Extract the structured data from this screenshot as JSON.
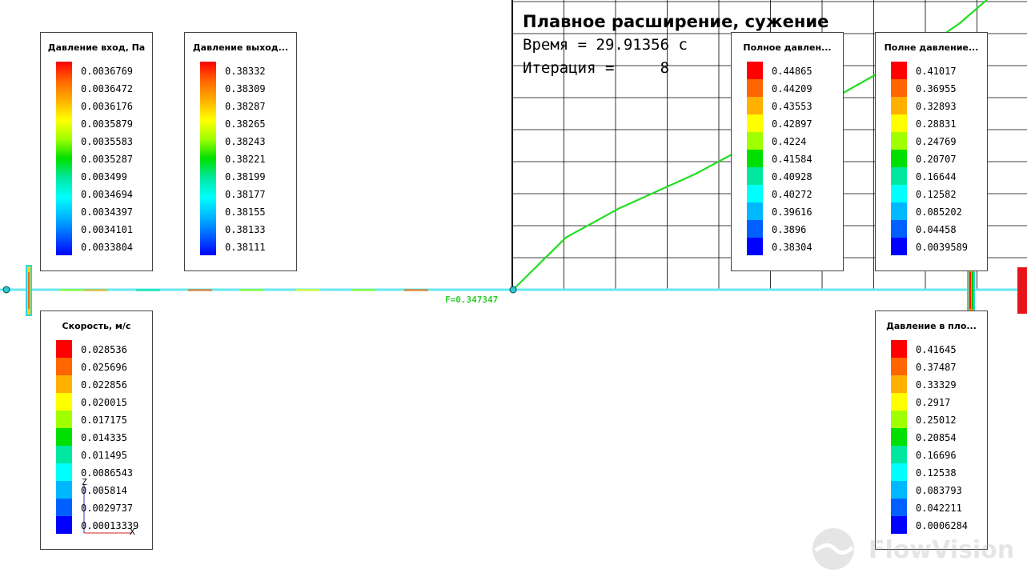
{
  "graph": {
    "title": "Плавное расширение, сужение",
    "time_line": "Время = 29.91356 с",
    "iteration_line": "Итерация =     8",
    "force_label": "F=0.347347",
    "line_color": "#22dd22",
    "curve_points": [
      [
        0,
        0
      ],
      [
        0.11,
        0.18
      ],
      [
        0.22,
        0.28
      ],
      [
        0.38,
        0.4
      ],
      [
        0.55,
        0.55
      ],
      [
        0.72,
        0.71
      ],
      [
        0.86,
        0.84
      ],
      [
        0.93,
        0.92
      ],
      [
        1.0,
        1.02
      ]
    ]
  },
  "legend_colors": [
    "#ff0000",
    "#ff6600",
    "#ffb000",
    "#ffff00",
    "#a0ff00",
    "#00e000",
    "#00e8a0",
    "#00ffff",
    "#00b8ff",
    "#0060ff",
    "#0000ff"
  ],
  "legends": {
    "inlet_pressure": {
      "title": "Давление вход, Па",
      "style": "gradient",
      "values": [
        "0.0036769",
        "0.0036472",
        "0.0036176",
        "0.0035879",
        "0.0035583",
        "0.0035287",
        "0.003499",
        "0.0034694",
        "0.0034397",
        "0.0034101",
        "0.0033804"
      ]
    },
    "outlet_pressure": {
      "title": "Давление выход...",
      "style": "gradient",
      "values": [
        "0.38332",
        "0.38309",
        "0.38287",
        "0.38265",
        "0.38243",
        "0.38221",
        "0.38199",
        "0.38177",
        "0.38155",
        "0.38133",
        "0.38111"
      ]
    },
    "total_pressure_1": {
      "title": "Полное давлен...",
      "style": "steps",
      "values": [
        "0.44865",
        "0.44209",
        "0.43553",
        "0.42897",
        "0.4224",
        "0.41584",
        "0.40928",
        "0.40272",
        "0.39616",
        "0.3896",
        "0.38304"
      ]
    },
    "total_pressure_2": {
      "title": "Полне давление...",
      "style": "steps",
      "values": [
        "0.41017",
        "0.36955",
        "0.32893",
        "0.28831",
        "0.24769",
        "0.20707",
        "0.16644",
        "0.12582",
        "0.085202",
        "0.04458",
        "0.0039589"
      ]
    },
    "velocity": {
      "title": "Скорость, м/с",
      "style": "steps",
      "values": [
        "0.028536",
        "0.025696",
        "0.022856",
        "0.020015",
        "0.017175",
        "0.014335",
        "0.011495",
        "0.0086543",
        "0.005814",
        "0.0029737",
        "0.00013339"
      ]
    },
    "plane_pressure": {
      "title": "Давление в пло...",
      "style": "steps",
      "values": [
        "0.41645",
        "0.37487",
        "0.33329",
        "0.2917",
        "0.25012",
        "0.20854",
        "0.16696",
        "0.12538",
        "0.083793",
        "0.042211",
        "0.0006284"
      ]
    }
  },
  "axes": {
    "z_label": "Z",
    "x_label": "X"
  },
  "watermark": {
    "text": "FlowVision"
  }
}
